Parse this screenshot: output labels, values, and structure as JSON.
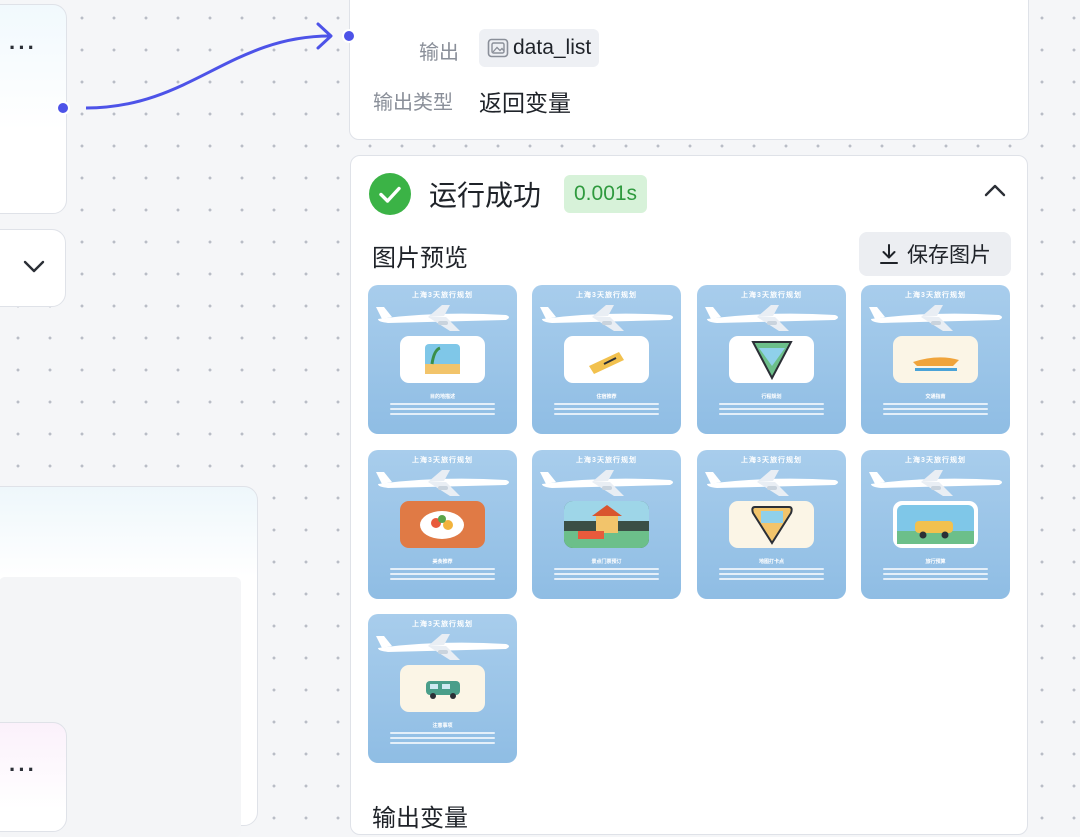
{
  "output": {
    "label": "输出",
    "variable": "data_list",
    "type_label": "输出类型",
    "type_value": "返回变量"
  },
  "result": {
    "status": "运行成功",
    "duration": "0.001s",
    "preview_title": "图片预览",
    "save_label": "保存图片",
    "output_var_label": "输出变量"
  },
  "thumbnails": [
    {
      "title": "上海3天旅行规划",
      "caption": "目的地描述",
      "icon": "beach-icon",
      "frame": "white"
    },
    {
      "title": "上海3天旅行规划",
      "caption": "住宿推荐",
      "icon": "ticket-icon",
      "frame": "white"
    },
    {
      "title": "上海3天旅行规划",
      "caption": "行程规划",
      "icon": "map-icon",
      "frame": "white"
    },
    {
      "title": "上海3天旅行规划",
      "caption": "交通指南",
      "icon": "seaplane-icon",
      "frame": "cream"
    },
    {
      "title": "上海3天旅行规划",
      "caption": "美食推荐",
      "icon": "food-icon",
      "frame": "orange"
    },
    {
      "title": "上海3天旅行规划",
      "caption": "景点门票预订",
      "icon": "landmark-icon",
      "frame": "dark"
    },
    {
      "title": "上海3天旅行规划",
      "caption": "地图打卡点",
      "icon": "map-pin-icon",
      "frame": "cream"
    },
    {
      "title": "上海3天旅行规划",
      "caption": "旅行预算",
      "icon": "car-icon",
      "frame": "white"
    },
    {
      "title": "上海3天旅行规划",
      "caption": "注意事项",
      "icon": "bus-icon",
      "frame": "cream"
    }
  ],
  "colors": {
    "accent": "#4d53e8",
    "success": "#3bb346",
    "success_bg": "#d7f2d9",
    "thumb_bg": "#a8cdec"
  }
}
